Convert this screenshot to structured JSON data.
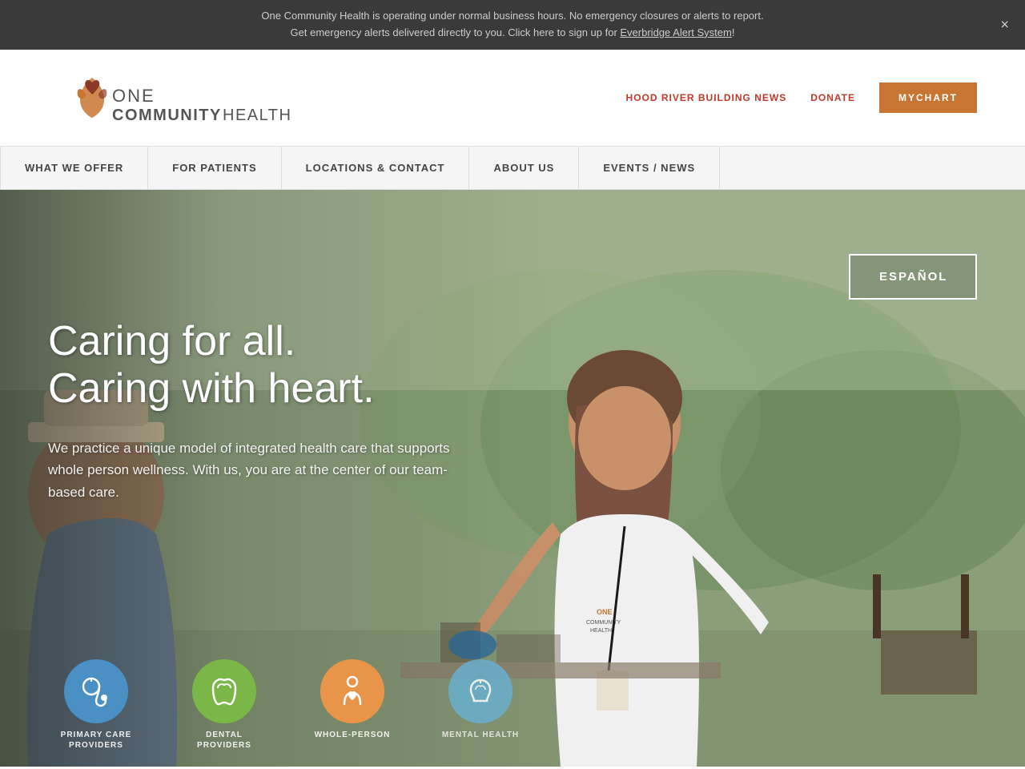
{
  "alert": {
    "line1": "One Community Health is operating under normal business hours. No emergency closures or alerts to report.",
    "line2_pre": "Get emergency alerts delivered directly to you. Click here to sign up for ",
    "line2_link": "Everbridge Alert System",
    "line2_post": "!",
    "close_icon": "×"
  },
  "header": {
    "logo_alt": "One Community Health",
    "nav_links": [
      {
        "label": "HOOD RIVER BUILDING NEWS",
        "id": "hood-river-news"
      },
      {
        "label": "DONATE",
        "id": "donate"
      }
    ],
    "mychart_label": "MYCHART"
  },
  "nav": {
    "items": [
      {
        "label": "WHAT WE OFFER",
        "id": "what-we-offer"
      },
      {
        "label": "FOR PATIENTS",
        "id": "for-patients"
      },
      {
        "label": "LOCATIONS & CONTACT",
        "id": "locations-contact"
      },
      {
        "label": "ABOUT US",
        "id": "about-us"
      },
      {
        "label": "EVENTS / NEWS",
        "id": "events-news"
      }
    ]
  },
  "hero": {
    "espanol_label": "ESPAÑOL",
    "heading_line1": "Caring for all.",
    "heading_line2": "Caring with heart.",
    "body_text": "We practice a unique model of integrated health care that supports whole person wellness. With us, you are at the center of our team-based care.",
    "icons": [
      {
        "label": "PRIMARY CARE\nPROVIDERS",
        "color": "blue",
        "id": "primary-care"
      },
      {
        "label": "DENTAL\nPROVIDERS",
        "color": "green",
        "id": "dental"
      },
      {
        "label": "WHOLE-PERSON",
        "color": "orange",
        "id": "whole-person"
      },
      {
        "label": "MENTAL HEALTH",
        "color": "lightblue",
        "id": "mental-health"
      }
    ]
  }
}
